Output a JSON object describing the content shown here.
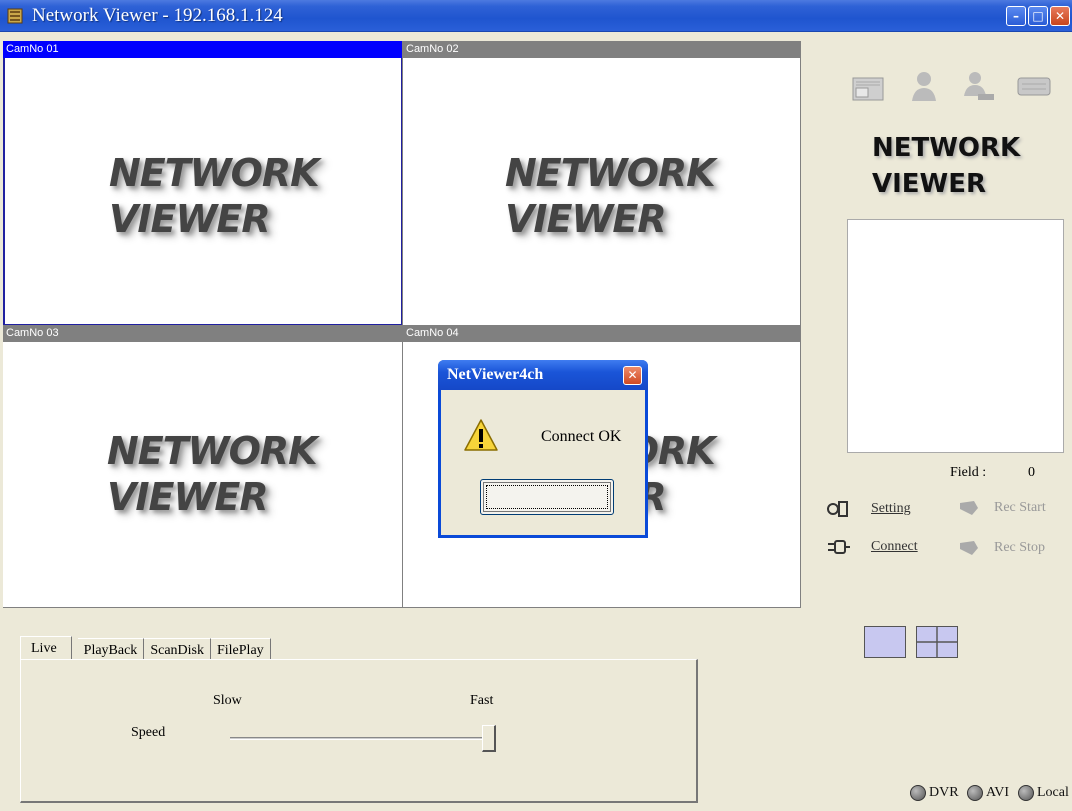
{
  "window": {
    "title": "Network Viewer - 192.168.1.124",
    "controls": [
      "minimize",
      "maximize",
      "close"
    ]
  },
  "cameras": [
    {
      "label": "CamNo 01",
      "line1": "NETWORK",
      "line2": "VIEWER",
      "active": true
    },
    {
      "label": "CamNo 02",
      "line1": "NETWORK",
      "line2": "VIEWER",
      "active": false
    },
    {
      "label": "CamNo 03",
      "line1": "NETWORK",
      "line2": "VIEWER",
      "active": false
    },
    {
      "label": "CamNo 04",
      "line1": "NETWORK",
      "line2": "VIEWER",
      "active": false
    }
  ],
  "right_panel": {
    "toolbar_icons": [
      "dvr-device-icon",
      "user-icon",
      "user-network-icon",
      "keyboard-icon"
    ],
    "brand_line1": "NETWORK",
    "brand_line2": "VIEWER",
    "field_label": "Field :",
    "field_value": "0",
    "controls": {
      "setting": "Setting",
      "rec_start": "Rec Start",
      "connect": "Connect",
      "rec_stop": "Rec Stop"
    },
    "layouts": [
      "single-view",
      "quad-view"
    ],
    "sources": [
      "DVR",
      "AVI",
      "Local"
    ]
  },
  "tabs": [
    {
      "label": "Live",
      "active": true
    },
    {
      "label": "PlayBack",
      "active": false
    },
    {
      "label": "ScanDisk",
      "active": false
    },
    {
      "label": "FilePlay",
      "active": false
    }
  ],
  "live_panel": {
    "slow_label": "Slow",
    "fast_label": "Fast",
    "speed_label": "Speed",
    "speed_value": 1.0
  },
  "dialog": {
    "title": "NetViewer4ch",
    "message": "Connect OK",
    "ok_label": "",
    "icon": "warning-icon"
  },
  "colors": {
    "titlebar": "#1f55cf",
    "active_cam_header": "#0000ff",
    "cam_header": "#808080",
    "window_bg": "#ece9d8"
  }
}
